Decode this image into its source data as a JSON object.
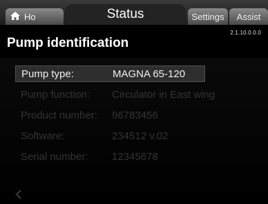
{
  "tabs": {
    "home": "Ho",
    "status": "Status",
    "settings": "Settings",
    "assist": "Assist"
  },
  "version": "2.1.10.0.0.0",
  "page_title": "Pump identification",
  "rows": [
    {
      "label": "Pump type:",
      "value": "MAGNA 65-120"
    },
    {
      "label": "Pump function:",
      "value": "Circulator in East wing"
    },
    {
      "label": "Product number:",
      "value": "96783456"
    },
    {
      "label": "Software:",
      "value": "234512 v.02"
    },
    {
      "label": "Serial number:",
      "value": "12345678"
    }
  ],
  "icons": {
    "home": "home-icon",
    "back": "back-arrow-icon"
  }
}
